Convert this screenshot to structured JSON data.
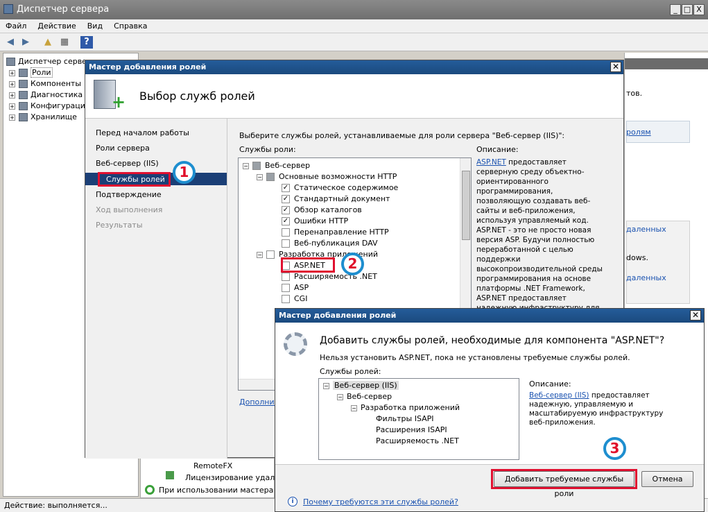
{
  "window": {
    "title": "Диспетчер сервера",
    "min": "_",
    "max": "□",
    "close": "X"
  },
  "menu": [
    "Файл",
    "Действие",
    "Вид",
    "Справка"
  ],
  "tree": {
    "root": "Диспетчер сервер",
    "items": [
      "Роли",
      "Компоненты",
      "Диагностика",
      "Конфигурация",
      "Хранилище"
    ]
  },
  "status_bar": "Действие:  выполняется...",
  "background": {
    "right_fragments": [
      "тов.",
      "ролям",
      "даленных",
      "dows.",
      "даленных"
    ],
    "bottom_items": [
      "RemoteFX",
      "Лицензирование удален",
      "При использовании мастера обн"
    ]
  },
  "wizard": {
    "title": "Мастер добавления ролей",
    "header": "Выбор служб ролей",
    "nav": [
      "Перед началом работы",
      "Роли сервера",
      "Веб-сервер (IIS)",
      "Службы ролей",
      "Подтверждение",
      "Ход выполнения",
      "Результаты"
    ],
    "instruction": "Выберите службы ролей, устанавливаемые для роли сервера \"Веб-сервер (IIS)\":",
    "services_label": "Службы роли:",
    "tree": [
      {
        "label": "Веб-сервер",
        "checked": "partial"
      },
      {
        "label": "Основные возможности HTTP",
        "checked": "partial"
      },
      {
        "label": "Статическое содержимое",
        "checked": "true"
      },
      {
        "label": "Стандартный документ",
        "checked": "true"
      },
      {
        "label": "Обзор каталогов",
        "checked": "true"
      },
      {
        "label": "Ошибки HTTP",
        "checked": "true"
      },
      {
        "label": "Перенаправление HTTP",
        "checked": "false"
      },
      {
        "label": "Веб-публикация DAV",
        "checked": "false"
      },
      {
        "label": "Разработка приложений",
        "checked": "false"
      },
      {
        "label": "ASP.NET",
        "checked": "false"
      },
      {
        "label": "Расширяемость .NET",
        "checked": "false"
      },
      {
        "label": "ASP",
        "checked": "false"
      },
      {
        "label": "CGI",
        "checked": "false"
      }
    ],
    "desc_label": "Описание:",
    "desc_link": "ASP.NET",
    "desc_text": " предоставляет серверную среду объектно-ориентированного программирования, позволяющую создавать веб-сайты и веб-приложения, используя управляемый код. ASP.NET - это не просто новая версия ASP. Будучи полностью переработанной с целью поддержки высокопроизводительной среды программирования на основе платформы .NET Framework, ASP.NET предоставляет надежную инфраструктуру для создания веб-приложений.",
    "more_link": "Дополнит"
  },
  "popup": {
    "title": "Мастер добавления ролей",
    "heading": "Добавить службы ролей, необходимые для компонента \"ASP.NET\"?",
    "message": "Нельзя установить ASP.NET, пока не установлены требуемые службы ролей.",
    "services_label": "Службы ролей:",
    "tree": [
      "Веб-сервер (IIS)",
      "Веб-сервер",
      "Разработка приложений",
      "Фильтры ISAPI",
      "Расширения ISAPI",
      "Расширяемость .NET"
    ],
    "desc_label": "Описание:",
    "desc_link": "Веб-сервер (IIS)",
    "desc_text": " предоставляет надежную, управляемую и масштабируемую инфраструктуру веб-приложения.",
    "add_button": "Добавить требуемые службы роли",
    "cancel_button": "Отмена",
    "help_link": "Почему требуются эти службы ролей?"
  },
  "badges": [
    "1",
    "2",
    "3"
  ],
  "colors": {
    "accent": "#1e8ecf",
    "highlight": "#e01030",
    "selection": "#1b3f76"
  }
}
